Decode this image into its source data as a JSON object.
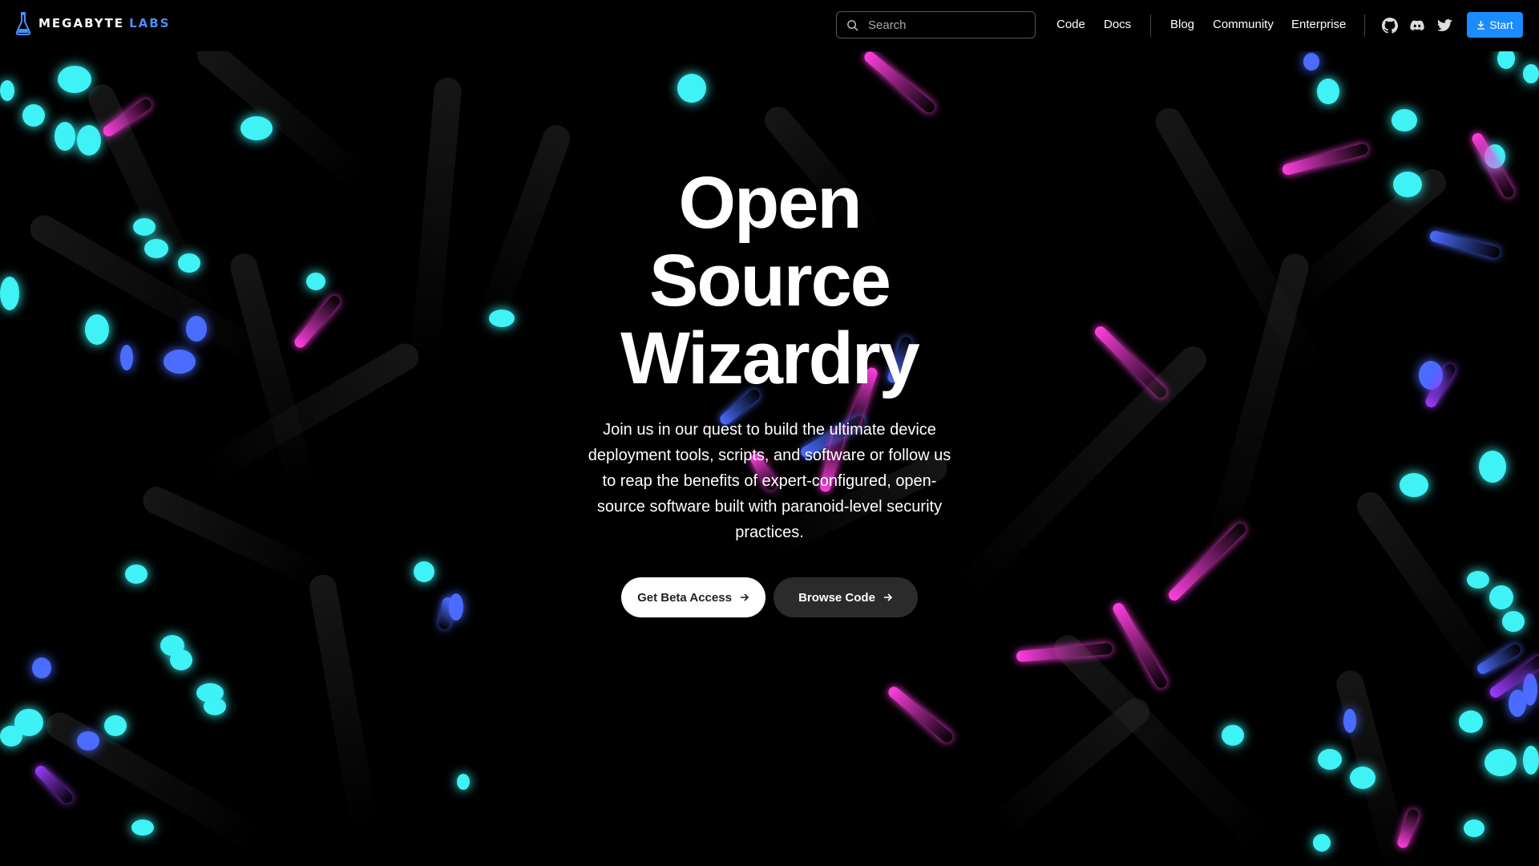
{
  "brand": {
    "name_part1": "MEGABYTE",
    "name_part2": "LABS",
    "accent_color": "#4a8dff"
  },
  "nav": {
    "search_placeholder": "Search",
    "links": [
      "Code",
      "Docs",
      "Blog",
      "Community",
      "Enterprise"
    ],
    "icons": [
      "github-icon",
      "discord-icon",
      "twitter-icon"
    ],
    "start_label": "Start",
    "start_color": "#1a8cff"
  },
  "hero": {
    "title_line1": "Open",
    "title_line2": "Source",
    "title_line3": "Wizardry",
    "subtitle": "Join us in our quest to build the ultimate device deployment tools, scripts, and software or follow us to reap the benefits of expert-configured, open-source software built with paranoid-level security practices.",
    "primary_cta": "Get Beta Access",
    "secondary_cta": "Browse Code"
  },
  "colors": {
    "background": "#000000",
    "particle_cyan": "#3ef2f5",
    "particle_blue": "#4a6cff",
    "particle_magenta": "#ff3fe0",
    "particle_violet": "#9b3dff"
  }
}
